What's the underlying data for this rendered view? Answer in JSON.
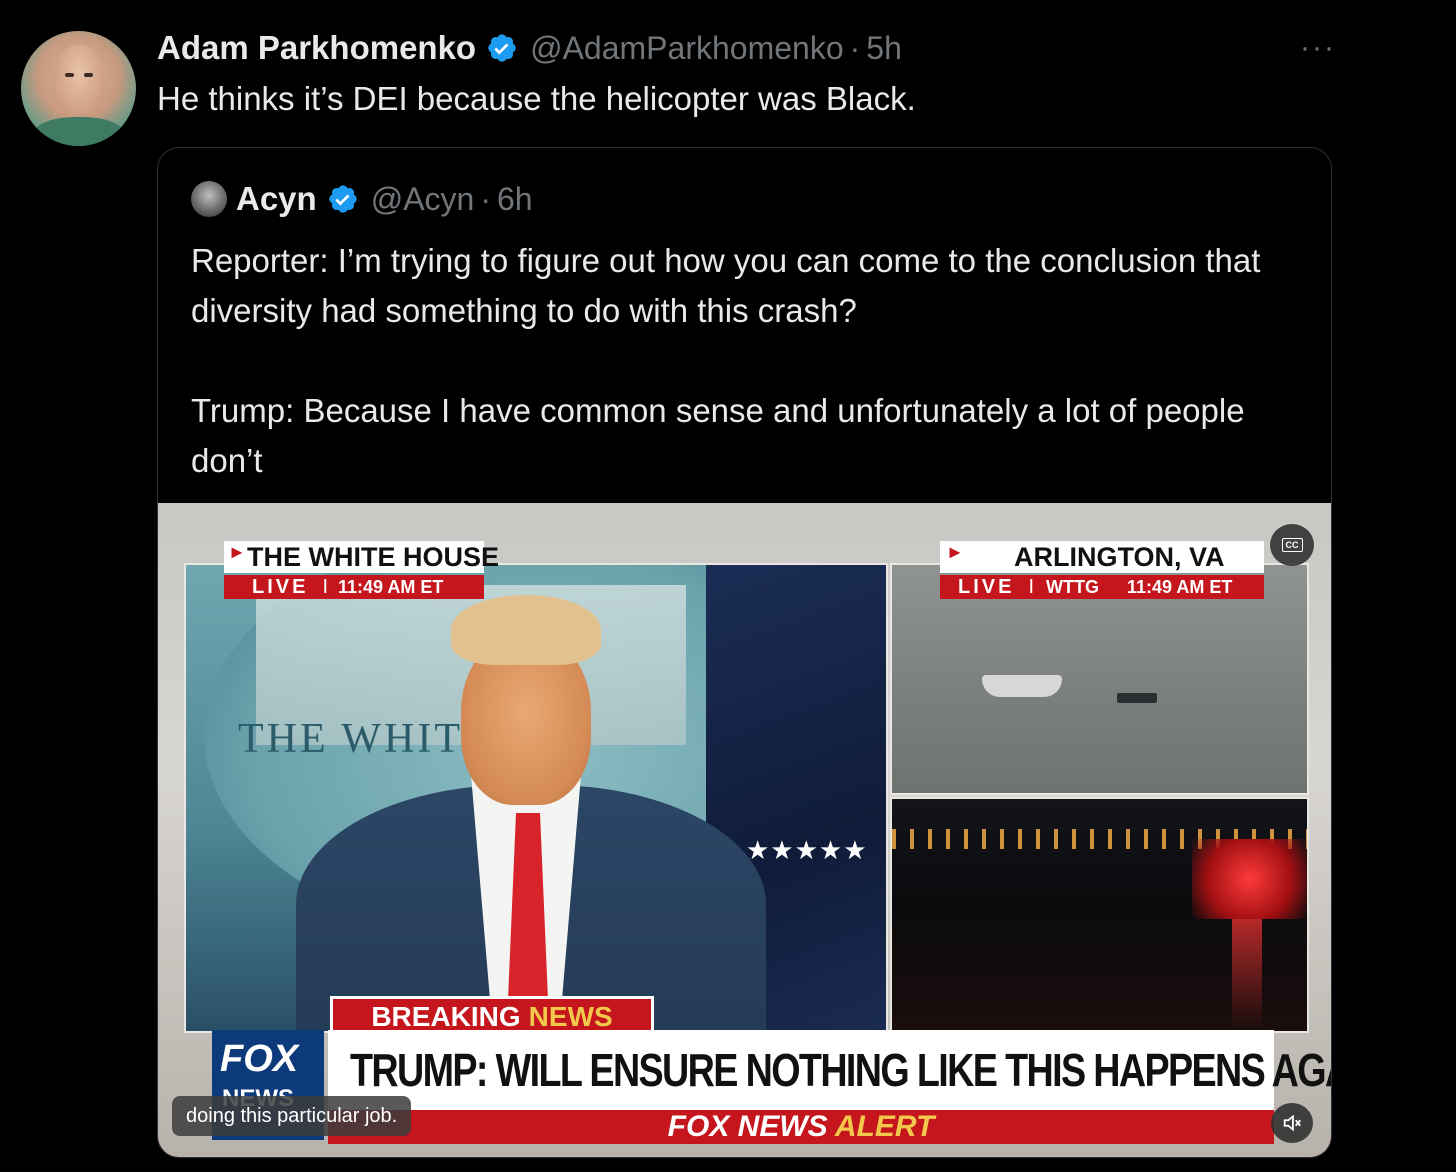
{
  "tweet": {
    "author_name": "Adam Parkhomenko",
    "handle": "@AdamParkhomenko",
    "separator": "·",
    "time": "5h",
    "more": "···",
    "text": "He thinks it’s DEI because the helicopter was Black."
  },
  "quote": {
    "author_name": "Acyn",
    "handle": "@Acyn",
    "separator": "·",
    "time": "6h",
    "paragraph1": "Reporter: I’m trying to figure out how you can come to the conclusion that diversity had something to do with this crash?",
    "paragraph2": "Trump: Because I have common sense and unfortunately a lot of people don’t"
  },
  "video": {
    "left_label_arrow": "►",
    "left_label_title": "THE WHITE HOUSE",
    "left_label_live": "LIVE",
    "left_label_sep": "I",
    "left_label_time": "11:49 AM ET",
    "background_text": "THE WHIT   USE",
    "right_label_arrow": "►",
    "right_label_title": "ARLINGTON, VA",
    "right_label_live": "LIVE",
    "right_label_sep": "I",
    "right_label_station": "WTTG",
    "right_label_time": "11:49 AM ET",
    "stars": "★★★★★",
    "cc_label": "CC",
    "breaking_white": "BREAKING",
    "breaking_gold": "NEWS",
    "headline": "TRUMP: WILL ENSURE NOTHING LIKE THIS HAPPENS AGAIN",
    "fox_line1": "FOX",
    "fox_line2": "NEWS",
    "alert_white": "FOX NEWS ",
    "alert_gold": "ALERT",
    "caption": "doing this particular job."
  },
  "colors": {
    "background": "#000000",
    "text_primary": "#e7e9ea",
    "text_secondary": "#71767b",
    "verified": "#1d9bf0",
    "fox_red": "#c4161c"
  },
  "icons": {
    "verified": "verified-badge-icon",
    "more": "more-icon",
    "cc": "closed-captions-icon",
    "mute": "muted-speaker-icon"
  }
}
